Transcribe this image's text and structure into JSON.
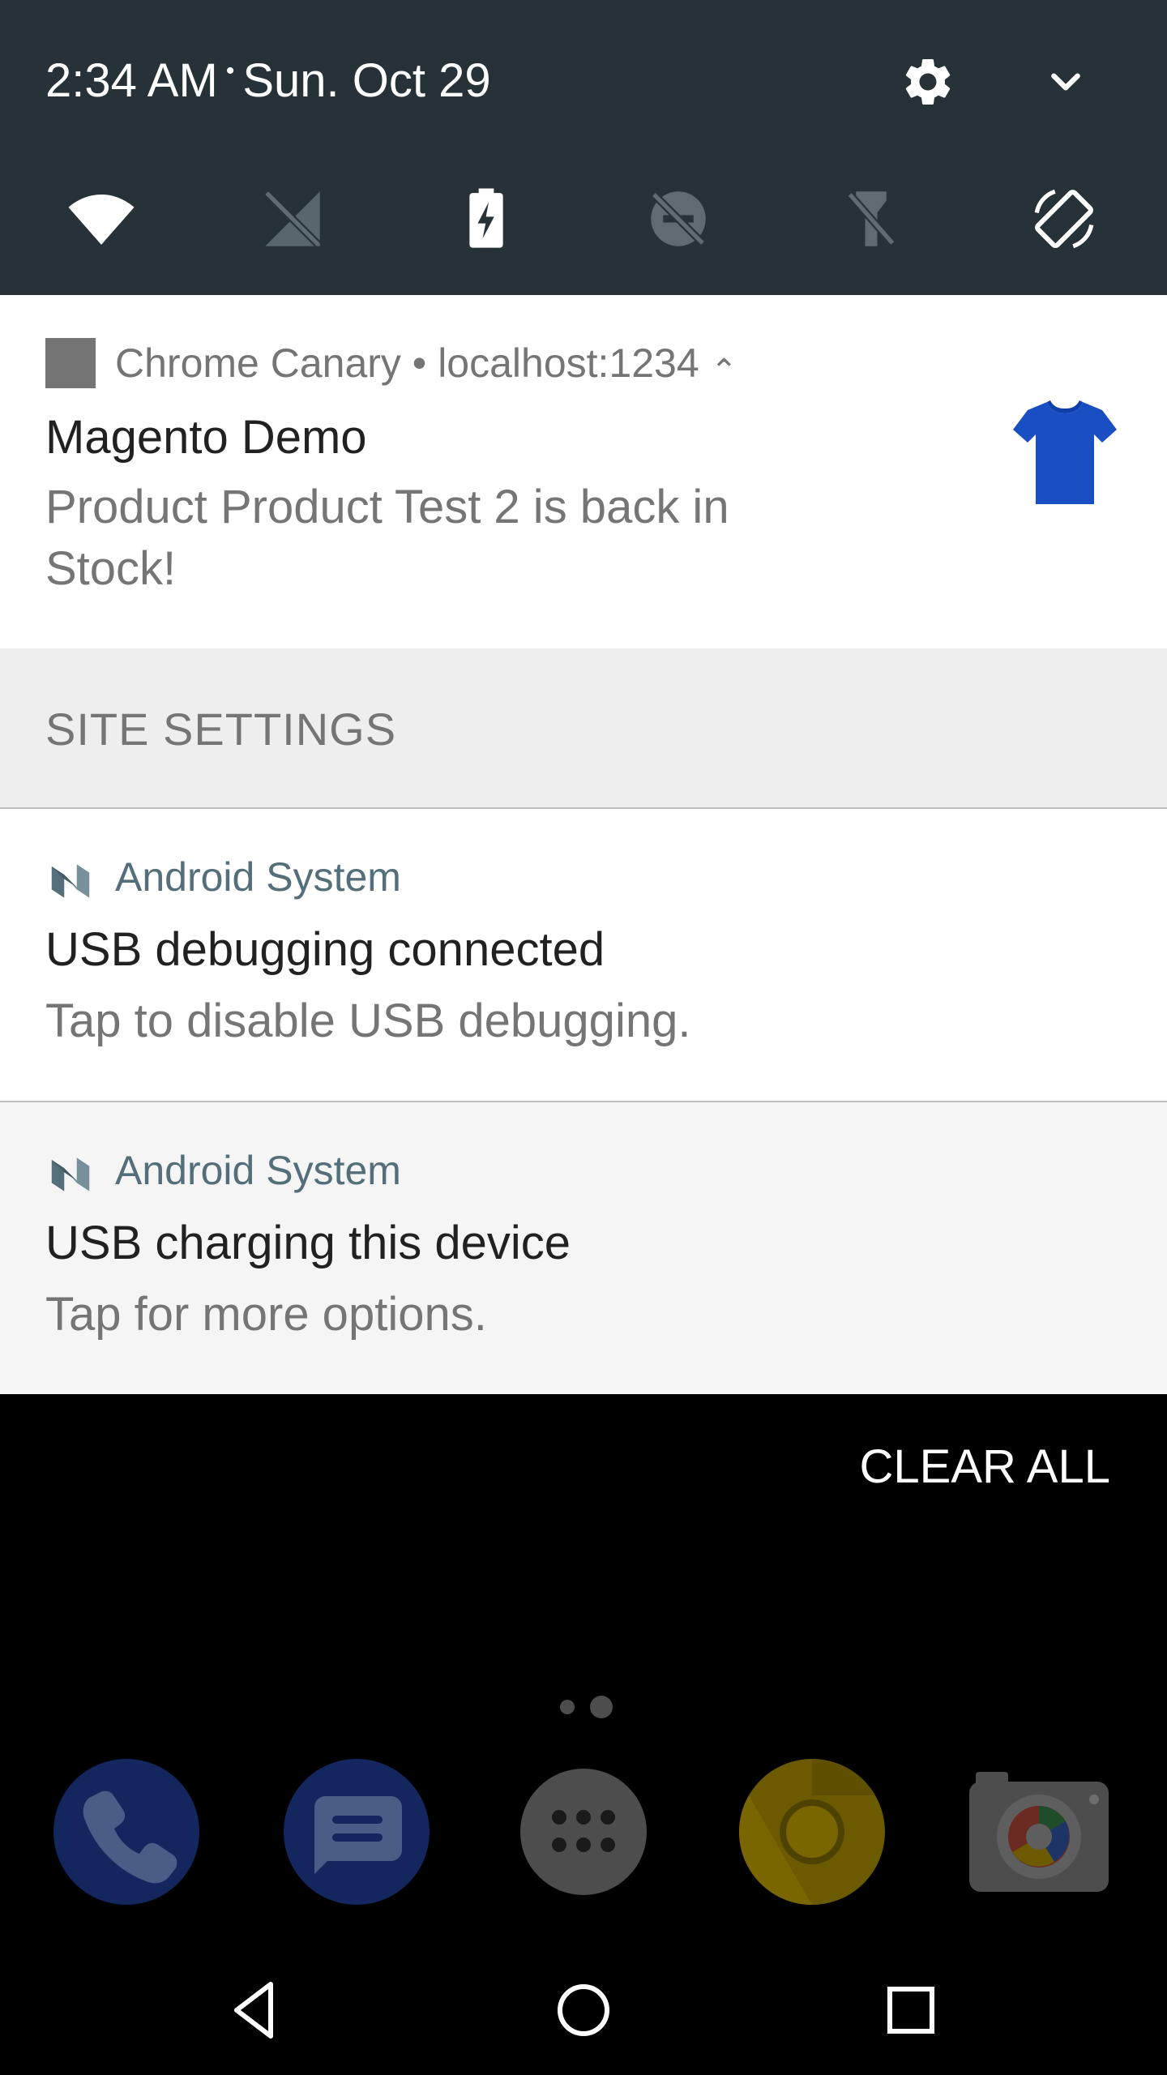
{
  "status": {
    "time": "2:34 AM",
    "separator": "•",
    "date": "Sun. Oct 29"
  },
  "quick_settings": {
    "icons": [
      "settings-gear-icon",
      "expand-chevron-icon"
    ],
    "tiles": [
      "wifi-icon",
      "mobile-data-off-icon",
      "battery-charging-icon",
      "do-not-disturb-off-icon",
      "flashlight-off-icon",
      "auto-rotate-icon"
    ]
  },
  "notifications": [
    {
      "app": "Chrome Canary • localhost:1234",
      "expander": "⌃",
      "title": "Magento Demo",
      "text": "Product Product Test 2 is back in Stock!",
      "thumbnail": "blue-tshirt-image"
    },
    {
      "app": "Android System",
      "title": "USB debugging connected",
      "text": "Tap to disable USB debugging."
    },
    {
      "app": "Android System",
      "title": "USB charging this device",
      "text": "Tap for more options."
    }
  ],
  "site_settings": {
    "label": "SITE SETTINGS"
  },
  "clear_all": {
    "label": "CLEAR ALL"
  },
  "dock": [
    "phone-icon",
    "messages-icon",
    "app-drawer-icon",
    "chrome-canary-icon",
    "camera-icon"
  ],
  "navigation": [
    "back-icon",
    "home-icon",
    "recents-icon"
  ],
  "colors": {
    "header_bg": "#263238",
    "android_system_text": "#546e7a",
    "secondary_text": "#757575"
  }
}
